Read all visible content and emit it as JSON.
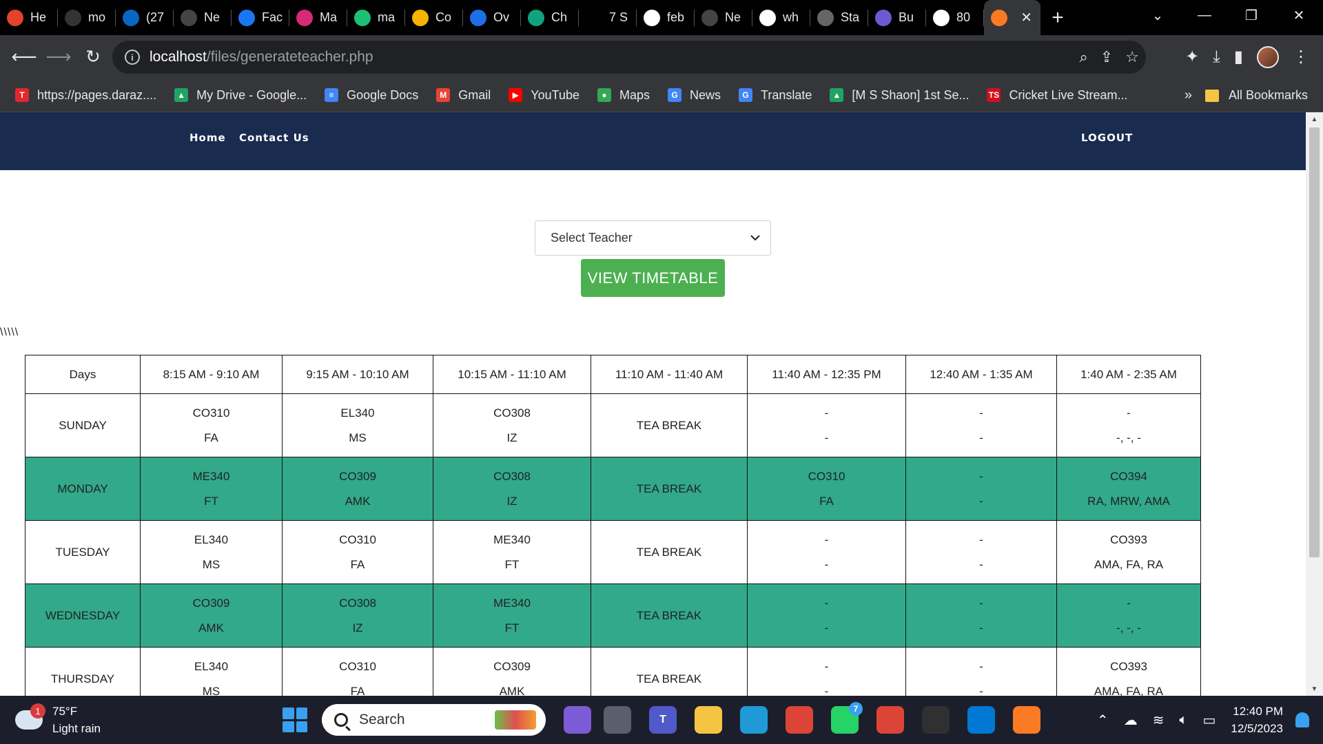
{
  "browser": {
    "tabs": [
      {
        "label": "He",
        "icon": "gitlab-icon",
        "color": "#e24329"
      },
      {
        "label": "mo",
        "icon": "github-icon",
        "color": "#333333"
      },
      {
        "label": "(27",
        "icon": "linkedin-icon",
        "color": "#0a66c2"
      },
      {
        "label": "Ne",
        "icon": "chatgpt-icon",
        "color": "#444444"
      },
      {
        "label": "Fac",
        "icon": "facebook-icon",
        "color": "#1877f2"
      },
      {
        "label": "Ma",
        "icon": "instagram-icon",
        "color": "#d62976"
      },
      {
        "label": "ma",
        "icon": "fiverr-icon",
        "color": "#1dbf73"
      },
      {
        "label": "Co",
        "icon": "chart-icon",
        "color": "#f4b400"
      },
      {
        "label": "Ov",
        "icon": "pocket-icon",
        "color": "#1e6ee8"
      },
      {
        "label": "Ch",
        "icon": "openai-icon",
        "color": "#10a37f"
      },
      {
        "label": "7 S",
        "icon": "f-icon",
        "color": "#000000"
      },
      {
        "label": "feb",
        "icon": "google-icon",
        "color": "#ffffff"
      },
      {
        "label": "Ne",
        "icon": "chatgpt-icon",
        "color": "#444444"
      },
      {
        "label": "wh",
        "icon": "google-icon",
        "color": "#ffffff"
      },
      {
        "label": "Sta",
        "icon": "globe-icon",
        "color": "#666666"
      },
      {
        "label": "Bu",
        "icon": "copy-icon",
        "color": "#6b5bd2"
      },
      {
        "label": "80",
        "icon": "google-icon",
        "color": "#ffffff"
      },
      {
        "label": "",
        "icon": "xampp-icon",
        "color": "#fb7a24",
        "active": true
      }
    ],
    "new_tab": "+",
    "url_host": "localhost",
    "url_path": "/files/generateteacher.php",
    "bookmarks": [
      {
        "label": "https://pages.daraz....",
        "icon": "t-icon",
        "color": "#e3262d",
        "glyph": "T"
      },
      {
        "label": "My Drive - Google...",
        "icon": "drive-icon",
        "color": "#1fa463",
        "glyph": "▲"
      },
      {
        "label": "Google Docs",
        "icon": "docs-icon",
        "color": "#4285f4",
        "glyph": "≡"
      },
      {
        "label": "Gmail",
        "icon": "gmail-icon",
        "color": "#ea4335",
        "glyph": "M"
      },
      {
        "label": "YouTube",
        "icon": "youtube-icon",
        "color": "#ff0000",
        "glyph": "▶"
      },
      {
        "label": "Maps",
        "icon": "maps-icon",
        "color": "#34a853",
        "glyph": "●"
      },
      {
        "label": "News",
        "icon": "news-icon",
        "color": "#4285f4",
        "glyph": "G"
      },
      {
        "label": "Translate",
        "icon": "translate-icon",
        "color": "#4285f4",
        "glyph": "G"
      },
      {
        "label": "[M S Shaon] 1st Se...",
        "icon": "drive-icon",
        "color": "#1fa463",
        "glyph": "▲"
      },
      {
        "label": "Cricket Live Stream...",
        "icon": "ts-icon",
        "color": "#d10f1f",
        "glyph": "TS"
      }
    ],
    "bookmarks_more": "»",
    "all_bookmarks": "All Bookmarks"
  },
  "site": {
    "nav": {
      "home": "Home",
      "contact": "Contact Us",
      "logout": "LOGOUT"
    },
    "select_placeholder": "Select Teacher",
    "view_button": "VIEW TIMETABLE",
    "stray_text": "\\\\\\\\\\",
    "timetable": {
      "headers": [
        "Days",
        "8:15 AM - 9:10 AM",
        "9:15 AM - 10:10 AM",
        "10:15 AM - 11:10 AM",
        "11:10 AM - 11:40 AM",
        "11:40 AM - 12:35 PM",
        "12:40 AM - 1:35 AM",
        "1:40 AM - 2:35 AM"
      ],
      "rows": [
        {
          "day": "SUNDAY",
          "cells": [
            [
              "CO310",
              "FA"
            ],
            [
              "EL340",
              "MS"
            ],
            [
              "CO308",
              "IZ"
            ],
            [
              "TEA BREAK"
            ],
            [
              "-",
              "-"
            ],
            [
              "-",
              "-"
            ],
            [
              "-",
              "-, -, -"
            ]
          ]
        },
        {
          "day": "MONDAY",
          "cells": [
            [
              "ME340",
              "FT"
            ],
            [
              "CO309",
              "AMK"
            ],
            [
              "CO308",
              "IZ"
            ],
            [
              "TEA BREAK"
            ],
            [
              "CO310",
              "FA"
            ],
            [
              "-",
              "-"
            ],
            [
              "CO394",
              "RA, MRW, AMA"
            ]
          ]
        },
        {
          "day": "TUESDAY",
          "cells": [
            [
              "EL340",
              "MS"
            ],
            [
              "CO310",
              "FA"
            ],
            [
              "ME340",
              "FT"
            ],
            [
              "TEA BREAK"
            ],
            [
              "-",
              "-"
            ],
            [
              "-",
              "-"
            ],
            [
              "CO393",
              "AMA, FA, RA"
            ]
          ]
        },
        {
          "day": "WEDNESDAY",
          "cells": [
            [
              "CO309",
              "AMK"
            ],
            [
              "CO308",
              "IZ"
            ],
            [
              "ME340",
              "FT"
            ],
            [
              "TEA BREAK"
            ],
            [
              "-",
              "-"
            ],
            [
              "-",
              "-"
            ],
            [
              "-",
              "-, -, -"
            ]
          ]
        },
        {
          "day": "THURSDAY",
          "cells": [
            [
              "EL340",
              "MS"
            ],
            [
              "CO310",
              "FA"
            ],
            [
              "CO309",
              "AMK"
            ],
            [
              "TEA BREAK"
            ],
            [
              "-",
              "-"
            ],
            [
              "-",
              "-"
            ],
            [
              "CO393",
              "AMA, FA, RA"
            ]
          ]
        }
      ],
      "alt_row_color": "#31a98a"
    },
    "colors": {
      "navbar": "#1a2b50",
      "button": "#4cb050"
    }
  },
  "taskbar": {
    "weather_temp": "75°F",
    "weather_desc": "Light rain",
    "weather_badge": "1",
    "search_label": "Search",
    "time": "12:40 PM",
    "date": "12/5/2023",
    "apps": [
      {
        "icon": "copilot-icon",
        "color": "#7b5cd6",
        "label": ""
      },
      {
        "icon": "task-view-icon",
        "color": "#5a5f6e",
        "label": ""
      },
      {
        "icon": "teams-icon",
        "color": "#5059c9",
        "label": "T"
      },
      {
        "icon": "file-explorer-icon",
        "color": "#f4c542",
        "label": ""
      },
      {
        "icon": "edge-icon",
        "color": "#1f9ad6",
        "label": ""
      },
      {
        "icon": "chrome-icon",
        "color": "#db4437",
        "label": ""
      },
      {
        "icon": "whatsapp-icon",
        "color": "#25d366",
        "label": "",
        "badge": "7"
      },
      {
        "icon": "chrome-profile-icon",
        "color": "#db4437",
        "label": ""
      },
      {
        "icon": "obs-icon",
        "color": "#303030",
        "label": ""
      },
      {
        "icon": "vscode-icon",
        "color": "#0078d4",
        "label": ""
      },
      {
        "icon": "xampp-icon",
        "color": "#fb7a24",
        "label": ""
      }
    ]
  }
}
